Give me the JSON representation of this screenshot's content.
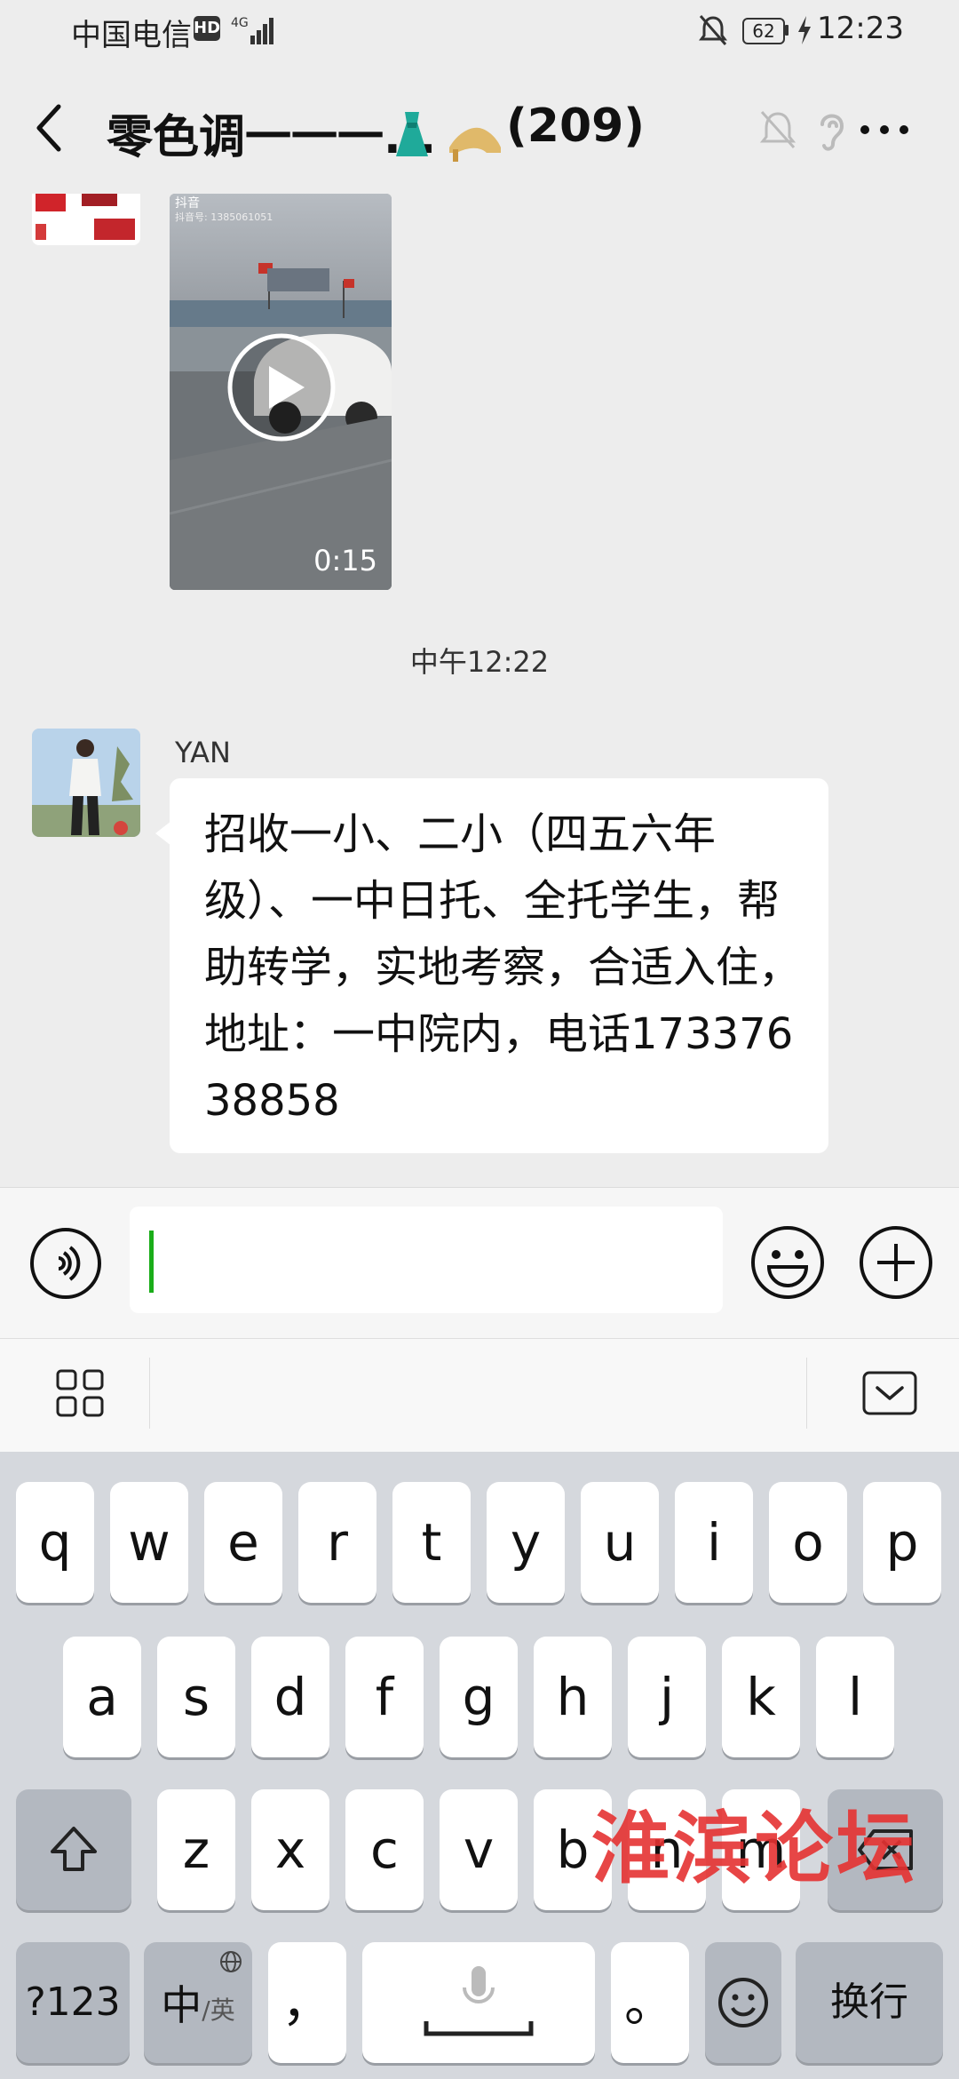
{
  "status_bar": {
    "carrier": "中国电信",
    "hd_badge": "HD",
    "network": "4G",
    "battery": "62",
    "time": "12:23"
  },
  "header": {
    "title": "零色调一一一...",
    "member_count": "(209)"
  },
  "messages": {
    "video": {
      "source_tag": "抖音",
      "account_label": "抖音号: 1385061051",
      "duration": "0:15"
    },
    "timestamp": "中午12:22",
    "text_message": {
      "sender": "YAN",
      "text": "招收一小、二小（四五六年级）、一中日托、全托学生，帮助转学，实地考察，合适入住，地址：一中院内，电话17337638858"
    }
  },
  "input": {
    "value": ""
  },
  "keyboard": {
    "row1": [
      "q",
      "w",
      "e",
      "r",
      "t",
      "y",
      "u",
      "i",
      "o",
      "p"
    ],
    "row2": [
      "a",
      "s",
      "d",
      "f",
      "g",
      "h",
      "j",
      "k",
      "l"
    ],
    "row3": [
      "z",
      "x",
      "c",
      "v",
      "b",
      "n",
      "m"
    ],
    "numbers_key": "?123",
    "lang_key_main": "中",
    "lang_key_sub": "/英",
    "comma_key": "，",
    "period_key": "。",
    "enter_key": "换行"
  },
  "watermark": "淮滨论坛"
}
